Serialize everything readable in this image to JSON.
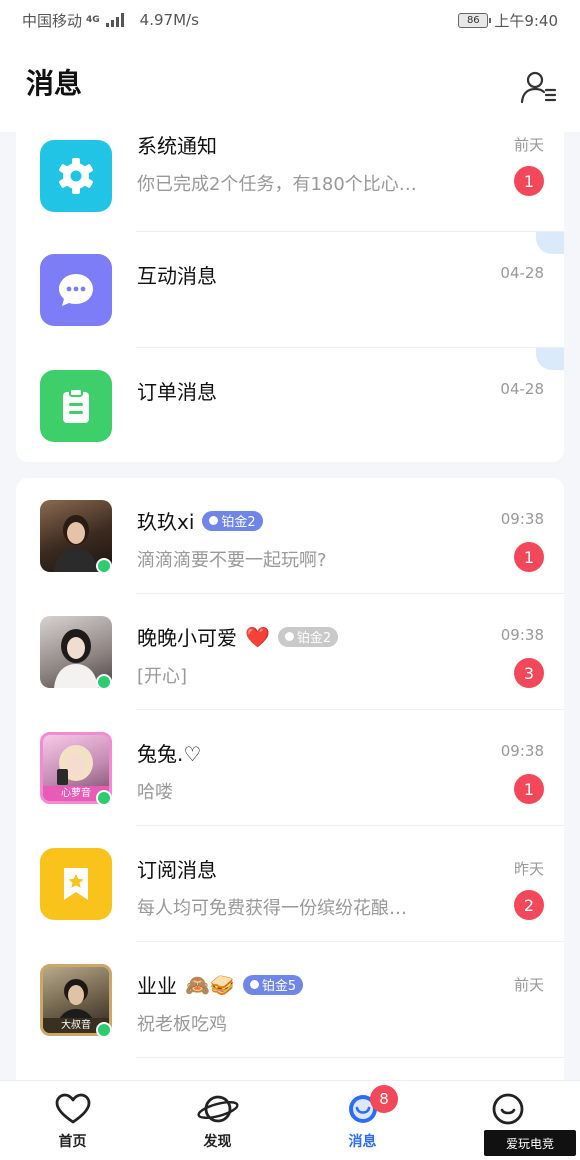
{
  "status_bar": {
    "carrier": "中国移动",
    "network": "4G",
    "speed": "4.97M/s",
    "battery": "86",
    "time": "上午9:40"
  },
  "header": {
    "title": "消息",
    "contacts_icon": "contacts-icon"
  },
  "system_items": [
    {
      "title": "系统通知",
      "preview": "你已完成2个任务，有180个比心…",
      "time": "前天",
      "unread": "1",
      "icon": "gear-icon",
      "color": "#22c4e6"
    },
    {
      "title": "互动消息",
      "preview": "",
      "time": "04-28",
      "unread": "",
      "icon": "chat-bubble-icon",
      "color": "#7d7ef7"
    },
    {
      "title": "订单消息",
      "preview": "",
      "time": "04-28",
      "unread": "",
      "icon": "clipboard-icon",
      "color": "#3fcf6a"
    }
  ],
  "conversations": [
    {
      "name": "玖玖xi",
      "badge": "铂金2",
      "badge_style": "blue",
      "preview": "滴滴滴要不要一起玩啊?",
      "time": "09:38",
      "unread": "1",
      "online": true
    },
    {
      "name": "晚晚小可爱",
      "emoji": "❤️",
      "badge": "铂金2",
      "badge_style": "gray",
      "preview": "[开心]",
      "time": "09:38",
      "unread": "3",
      "online": true
    },
    {
      "name": "兔兔.♡",
      "badge": "",
      "preview": "哈喽",
      "time": "09:38",
      "unread": "1",
      "online": true,
      "avatar_tag": "心萝音"
    },
    {
      "name": "订阅消息",
      "badge": "",
      "preview": "每人均可免费获得一份缤纷花酿…",
      "time": "昨天",
      "unread": "2",
      "online": false,
      "icon": "bookmark-star-icon",
      "color": "#f9c31c"
    },
    {
      "name": "业业",
      "emoji": "🙈🥪",
      "badge": "铂金5",
      "badge_style": "blue",
      "preview": "祝老板吃鸡",
      "time": "前天",
      "unread": "",
      "online": true,
      "avatar_tag": "大叔音"
    }
  ],
  "bottom_nav": {
    "items": [
      {
        "label": "首页",
        "icon": "heart-icon"
      },
      {
        "label": "发现",
        "icon": "planet-icon"
      },
      {
        "label": "消息",
        "icon": "message-icon",
        "badge": "8"
      },
      {
        "label": "",
        "icon": "smile-icon"
      }
    ]
  },
  "watermark": "爱玩电竞",
  "colors": {
    "accent": "#2d6cf6",
    "badge_red": "#f2485a",
    "online_green": "#2ecc71"
  }
}
